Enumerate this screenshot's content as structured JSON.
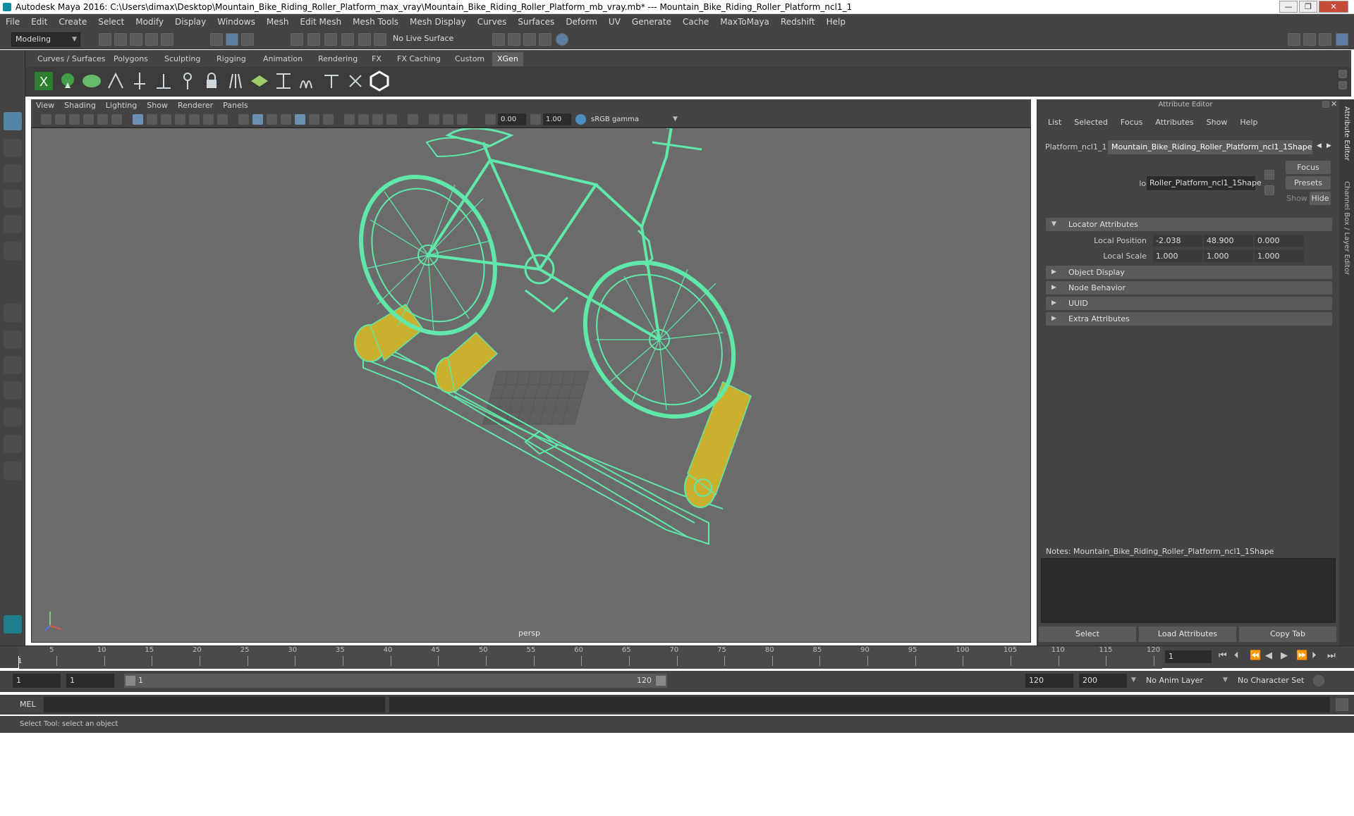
{
  "window": {
    "title": "Autodesk Maya 2016: C:\\Users\\dimax\\Desktop\\Mountain_Bike_Riding_Roller_Platform_max_vray\\Mountain_Bike_Riding_Roller_Platform_mb_vray.mb*   ---   Mountain_Bike_Riding_Roller_Platform_ncl1_1",
    "min": "—",
    "max": "❐",
    "close": "✕"
  },
  "menu": [
    "File",
    "Edit",
    "Create",
    "Select",
    "Modify",
    "Display",
    "Windows",
    "Mesh",
    "Edit Mesh",
    "Mesh Tools",
    "Mesh Display",
    "Curves",
    "Surfaces",
    "Deform",
    "UV",
    "Generate",
    "Cache",
    "MaxToMaya",
    "Redshift",
    "Help"
  ],
  "status": {
    "mode": "Modeling",
    "live_surface": "No Live Surface"
  },
  "shelf_tabs": [
    "Curves / Surfaces",
    "Polygons",
    "Sculpting",
    "Rigging",
    "Animation",
    "Rendering",
    "FX",
    "FX Caching",
    "Custom",
    "XGen"
  ],
  "active_shelf_tab": "XGen",
  "viewport": {
    "menu": [
      "View",
      "Shading",
      "Lighting",
      "Show",
      "Renderer",
      "Panels"
    ],
    "exposure": "0.00",
    "gamma": "1.00",
    "color_space": "sRGB gamma",
    "camera_label": "persp"
  },
  "attribute_editor": {
    "title": "Attribute Editor",
    "menu": [
      "List",
      "Selected",
      "Focus",
      "Attributes",
      "Show",
      "Help"
    ],
    "tabs": [
      "Platform_ncl1_1",
      "Mountain_Bike_Riding_Roller_Platform_ncl1_1Shape"
    ],
    "focus_btn": "Focus",
    "presets_btn": "Presets",
    "show_btn": "Show",
    "hide_btn": "Hide",
    "locator_label": "locator:",
    "locator_value": "Roller_Platform_ncl1_1Shape",
    "sections": {
      "locator": "Locator Attributes",
      "object_display": "Object Display",
      "node_behavior": "Node Behavior",
      "uuid": "UUID",
      "extra": "Extra Attributes"
    },
    "local_position_label": "Local Position",
    "local_position": [
      "-2.038",
      "48.900",
      "0.000"
    ],
    "local_scale_label": "Local Scale",
    "local_scale": [
      "1.000",
      "1.000",
      "1.000"
    ],
    "notes_label": "Notes:  Mountain_Bike_Riding_Roller_Platform_ncl1_1Shape",
    "buttons": {
      "select": "Select",
      "load": "Load Attributes",
      "copy": "Copy Tab"
    },
    "side_tab_1": "Attribute Editor",
    "side_tab_2": "Channel Box / Layer Editor"
  },
  "timeline": {
    "ticks": [
      "5",
      "10",
      "15",
      "20",
      "25",
      "30",
      "35",
      "40",
      "45",
      "50",
      "55",
      "60",
      "65",
      "70",
      "75",
      "80",
      "85",
      "90",
      "95",
      "100",
      "105",
      "110",
      "115",
      "120"
    ],
    "start_marker": "1",
    "current_frame": "1"
  },
  "range": {
    "start": "1",
    "playback_start": "1",
    "slider_start": "1",
    "slider_end": "120",
    "playback_end": "120",
    "end": "200",
    "anim_layer": "No Anim Layer",
    "character_set": "No Character Set"
  },
  "command": {
    "lang": "MEL"
  },
  "help": "Select Tool: select an object",
  "colors": {
    "wire": "#5fe8a8",
    "roller": "#c9b02e",
    "viewport_bg": "#6c6c6c"
  }
}
